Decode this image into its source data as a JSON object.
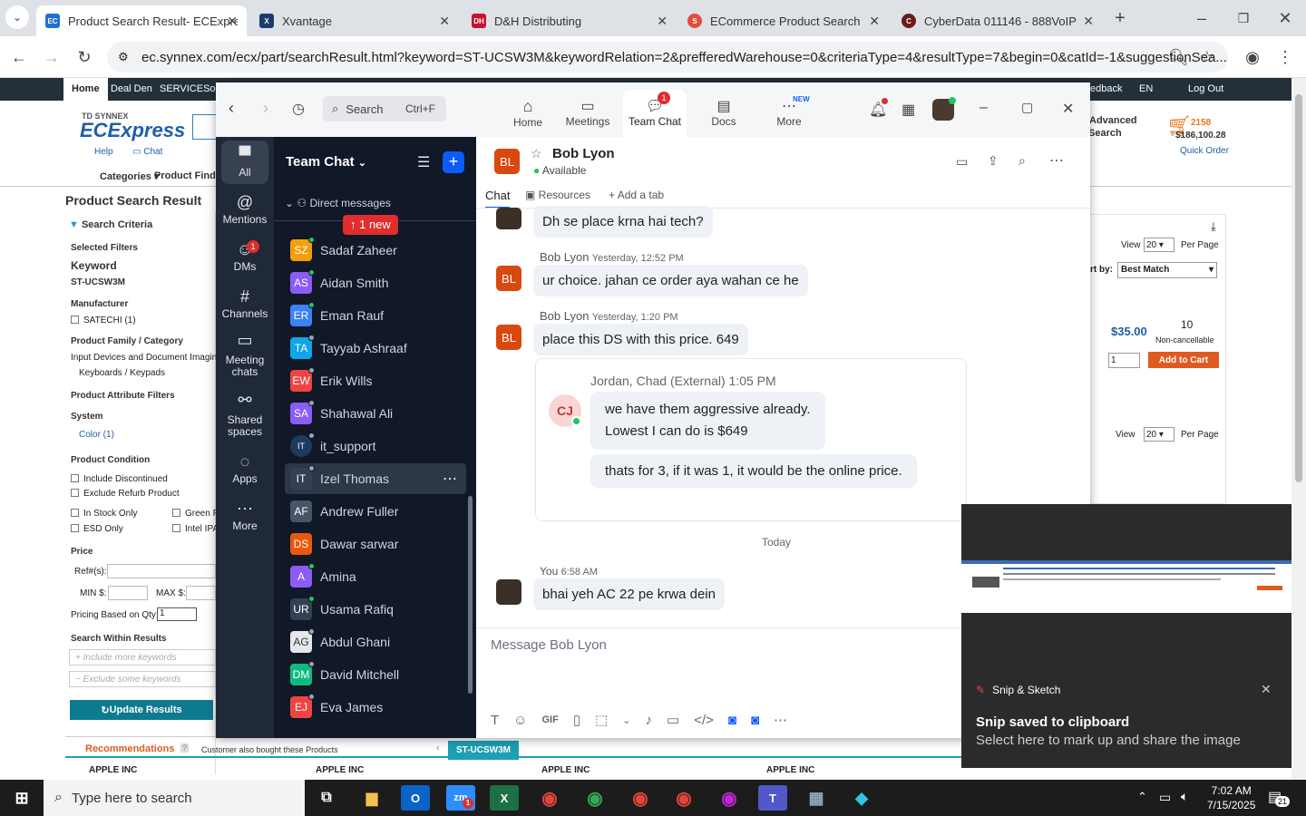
{
  "browser": {
    "tabs": [
      {
        "title": "Product Search Result- ECExpre",
        "active": true,
        "color": "#1f6fd6",
        "glyph": "EC"
      },
      {
        "title": "Xvantage",
        "active": false,
        "color": "#1b3d6b",
        "glyph": "X"
      },
      {
        "title": "D&H Distributing",
        "active": false,
        "color": "#c8102e",
        "glyph": "DH"
      },
      {
        "title": "ECommerce Product Search",
        "active": false,
        "color": "#e24d3c",
        "glyph": "S"
      },
      {
        "title": "CyberData 011146 - 888VoIP",
        "active": false,
        "color": "#6a1b1b",
        "glyph": "C"
      }
    ],
    "url": "ec.synnex.com/ecx/part/searchResult.html?keyword=ST-UCSW3M&keywordRelation=2&prefferedWarehouse=0&criteriaType=4&resultType=7&begin=0&catId=-1&suggestionSea..."
  },
  "site": {
    "nav": [
      "Home",
      "Deal Den",
      "SERVICESolv"
    ],
    "nav_right": [
      "edback",
      "EN",
      "Log Out"
    ],
    "brand_small": "TD SYNNEX",
    "brand": "ECExpress",
    "help": "Help",
    "chat": "Chat",
    "categories": "Categories",
    "product_finder": "Product Finde",
    "advanced": "Advanced",
    "search": "Search",
    "cart_count": "2158",
    "cart_total": "$186,100.28",
    "quick_order": "Quick Order",
    "page_title": "Product Search Result",
    "search_criteria": "Search Criteria",
    "selected_filters": "Selected Filters",
    "keyword_label": "Keyword",
    "keyword_value": "ST-UCSW3M",
    "manufacturer": "Manufacturer",
    "mfr_option": "SATECHI (1)",
    "family": "Product Family / Category",
    "family_1": "Input Devices and Document Imaging",
    "family_2": "Keyboards / Keypads",
    "attr_filters": "Product Attribute Filters",
    "system": "System",
    "color_opt": "Color (1)",
    "condition": "Product Condition",
    "include_disc": "Include Discontinued",
    "exclude_refurb": "Exclude Refurb Product",
    "in_stock": "In Stock Only",
    "green": "Green F",
    "esd": "ESD Only",
    "intel": "Intel IPA",
    "price": "Price",
    "ref": "Ref#(s):",
    "min": "MIN $:",
    "max": "MAX $:",
    "pricing_qty": "Pricing Based on Qty:",
    "qty_value": "1",
    "within": "Search Within Results",
    "include_kw": "Include more keywords",
    "exclude_kw": "Exclude some keywords",
    "update": "Update Results",
    "view": "View",
    "per_page": "Per Page",
    "view_n": "20",
    "sort_by": "rt by:",
    "sort_val": "Best Match",
    "price_val": "$35.00",
    "stock": "10",
    "noncancel": "Non-cancellable",
    "qty": "1",
    "add_cart": "Add to Cart",
    "reco": "Recommendations",
    "reco_sub": "Customer also bought these Products",
    "reco_tab": "ST-UCSW3M",
    "brands": [
      "APPLE INC",
      "APPLE INC",
      "APPLE INC",
      "APPLE INC"
    ]
  },
  "zoom": {
    "search": "Search",
    "shortcut": "Ctrl+F",
    "nav": [
      {
        "label": "Home"
      },
      {
        "label": "Meetings"
      },
      {
        "label": "Team Chat",
        "badge": "1"
      },
      {
        "label": "Docs"
      },
      {
        "label": "More",
        "badge": "NEW"
      }
    ],
    "rail": [
      {
        "label": "All"
      },
      {
        "label": "Mentions"
      },
      {
        "label": "DMs",
        "badge": "1"
      },
      {
        "label": "Channels"
      },
      {
        "label": "Meeting chats"
      },
      {
        "label": "Shared spaces"
      },
      {
        "label": "Apps"
      },
      {
        "label": "More"
      }
    ],
    "list_title": "Team Chat",
    "section": "Direct messages",
    "new_pill": "↑ 1 new",
    "contacts": [
      {
        "initials": "SZ",
        "name": "Sadaf Zaheer",
        "color": "#f59e0b"
      },
      {
        "initials": "AS",
        "name": "Aidan Smith",
        "color": "#8b5cf6"
      },
      {
        "initials": "ER",
        "name": "Eman Rauf",
        "color": "#3b82f6"
      },
      {
        "initials": "TA",
        "name": "Tayyab Ashraaf",
        "color": "#0ea5e9"
      },
      {
        "initials": "EW",
        "name": "Erik Wills",
        "color": "#ef4444"
      },
      {
        "initials": "SA",
        "name": "Shahawal Ali",
        "color": "#8b5cf6"
      },
      {
        "initials": "IT",
        "name": "it_support",
        "color": "#1e3a5f"
      },
      {
        "initials": "IT",
        "name": "Izel Thomas",
        "color": "#334155"
      },
      {
        "initials": "AF",
        "name": "Andrew Fuller",
        "color": "#475569"
      },
      {
        "initials": "DS",
        "name": "Dawar sarwar",
        "color": "#ea580c"
      },
      {
        "initials": "A",
        "name": "Amina",
        "color": "#8b5cf6"
      },
      {
        "initials": "UR",
        "name": "Usama Rafiq",
        "color": "#334155"
      },
      {
        "initials": "AG",
        "name": "Abdul Ghani",
        "color": "#e5e7eb"
      },
      {
        "initials": "DM",
        "name": "David Mitchell",
        "color": "#10b981"
      },
      {
        "initials": "EJ",
        "name": "Eva James",
        "color": "#ef4444"
      }
    ],
    "chat": {
      "name": "Bob Lyon",
      "initials": "BL",
      "status": "Available",
      "tabs": [
        "Chat",
        "Resources",
        "Add a tab"
      ],
      "messages": [
        {
          "text": "Dh se place krna hai tech?"
        },
        {
          "sender": "Bob Lyon",
          "time": "Yesterday, 12:52 PM",
          "text": "ur choice. jahan ce order aya wahan ce he"
        },
        {
          "sender": "Bob Lyon",
          "time": "Yesterday, 1:20 PM",
          "text": "place this DS with this price. 649"
        },
        {
          "sender": "Jordan, Chad (External)",
          "time": "1:05 PM",
          "initials": "CJ",
          "text1": "we have them aggressive already.",
          "text2": "Lowest I can do is $649",
          "text3": "thats for 3, if it was 1, it would be the online price."
        },
        {
          "divider": "Today"
        },
        {
          "sender": "You",
          "time": "6:58 AM",
          "text": "bhai yeh AC 22 pe krwa dein"
        }
      ],
      "placeholder": "Message Bob Lyon",
      "gif": "GIF"
    }
  },
  "snip": {
    "app": "Snip & Sketch",
    "title": "Snip saved to clipboard",
    "body": "Select here to mark up and share the image"
  },
  "taskbar": {
    "search": "Type here to search",
    "time": "7:02 AM",
    "date": "7/15/2025",
    "notif": "21",
    "zoom_badge": "1"
  }
}
